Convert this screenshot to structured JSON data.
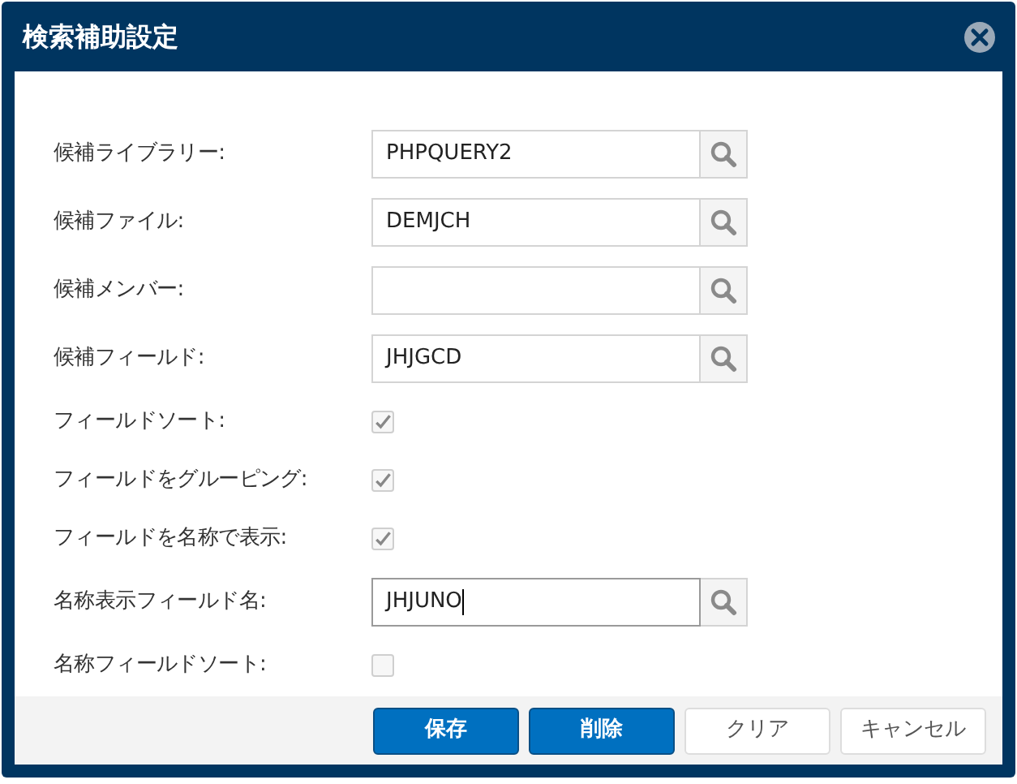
{
  "window": {
    "title": "検索補助設定"
  },
  "rows": [
    {
      "kind": "field",
      "label": "候補ライブラリー:",
      "value": "PHPQUERY2",
      "focused": false
    },
    {
      "kind": "field",
      "label": "候補ファイル:",
      "value": "DEMJCH",
      "focused": false
    },
    {
      "kind": "field",
      "label": "候補メンバー:",
      "value": "",
      "focused": false
    },
    {
      "kind": "field",
      "label": "候補フィールド:",
      "value": "JHJGCD",
      "focused": false
    },
    {
      "kind": "checkbox",
      "label": "フィールドソート:",
      "checked": true
    },
    {
      "kind": "checkbox",
      "label": "フィールドをグルーピング:",
      "checked": true
    },
    {
      "kind": "checkbox",
      "label": "フィールドを名称で表示:",
      "checked": true
    },
    {
      "kind": "field",
      "label": "名称表示フィールド名:",
      "value": "JHJUNO",
      "focused": true
    },
    {
      "kind": "checkbox",
      "label": "名称フィールドソート:",
      "checked": false
    }
  ],
  "buttons": [
    {
      "label": "保存",
      "kind": "primary"
    },
    {
      "label": "削除",
      "kind": "primary"
    },
    {
      "label": "クリア",
      "kind": "secondary"
    },
    {
      "label": "キャンセル",
      "kind": "secondary"
    }
  ]
}
